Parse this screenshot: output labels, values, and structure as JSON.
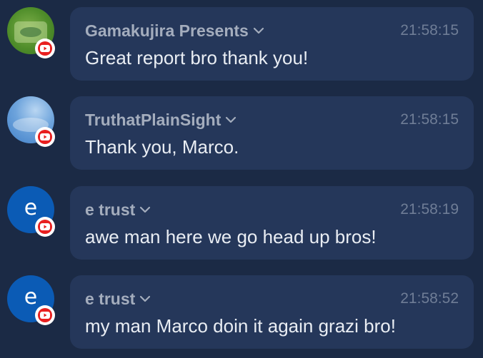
{
  "messages": [
    {
      "author": "Gamakujira Presents",
      "time": "21:58:15",
      "text": "Great report bro thank you!",
      "avatar": "image",
      "avatar_letter": "",
      "avatar_text": "Gamakujira Presents",
      "platform_icon": "youtube-icon"
    },
    {
      "author": "TruthatPlainSight",
      "time": "21:58:15",
      "text": "Thank you, Marco.",
      "avatar": "image",
      "avatar_letter": "",
      "platform_icon": "youtube-icon"
    },
    {
      "author": "e trust",
      "time": "21:58:19",
      "text": "awe man here we go head up bros!",
      "avatar": "letter",
      "avatar_letter": "e",
      "platform_icon": "youtube-icon"
    },
    {
      "author": "e trust",
      "time": "21:58:52",
      "text": "my man Marco doin it again grazi bro!",
      "avatar": "letter",
      "avatar_letter": "e",
      "platform_icon": "youtube-icon"
    }
  ],
  "colors": {
    "background": "#1b2a45",
    "bubble": "#25375a",
    "author": "#a4adbd",
    "time": "#6f7d96",
    "text": "#e9edf3",
    "youtube_red": "#e81f1f",
    "letter_avatar": "#0b5bb5"
  }
}
